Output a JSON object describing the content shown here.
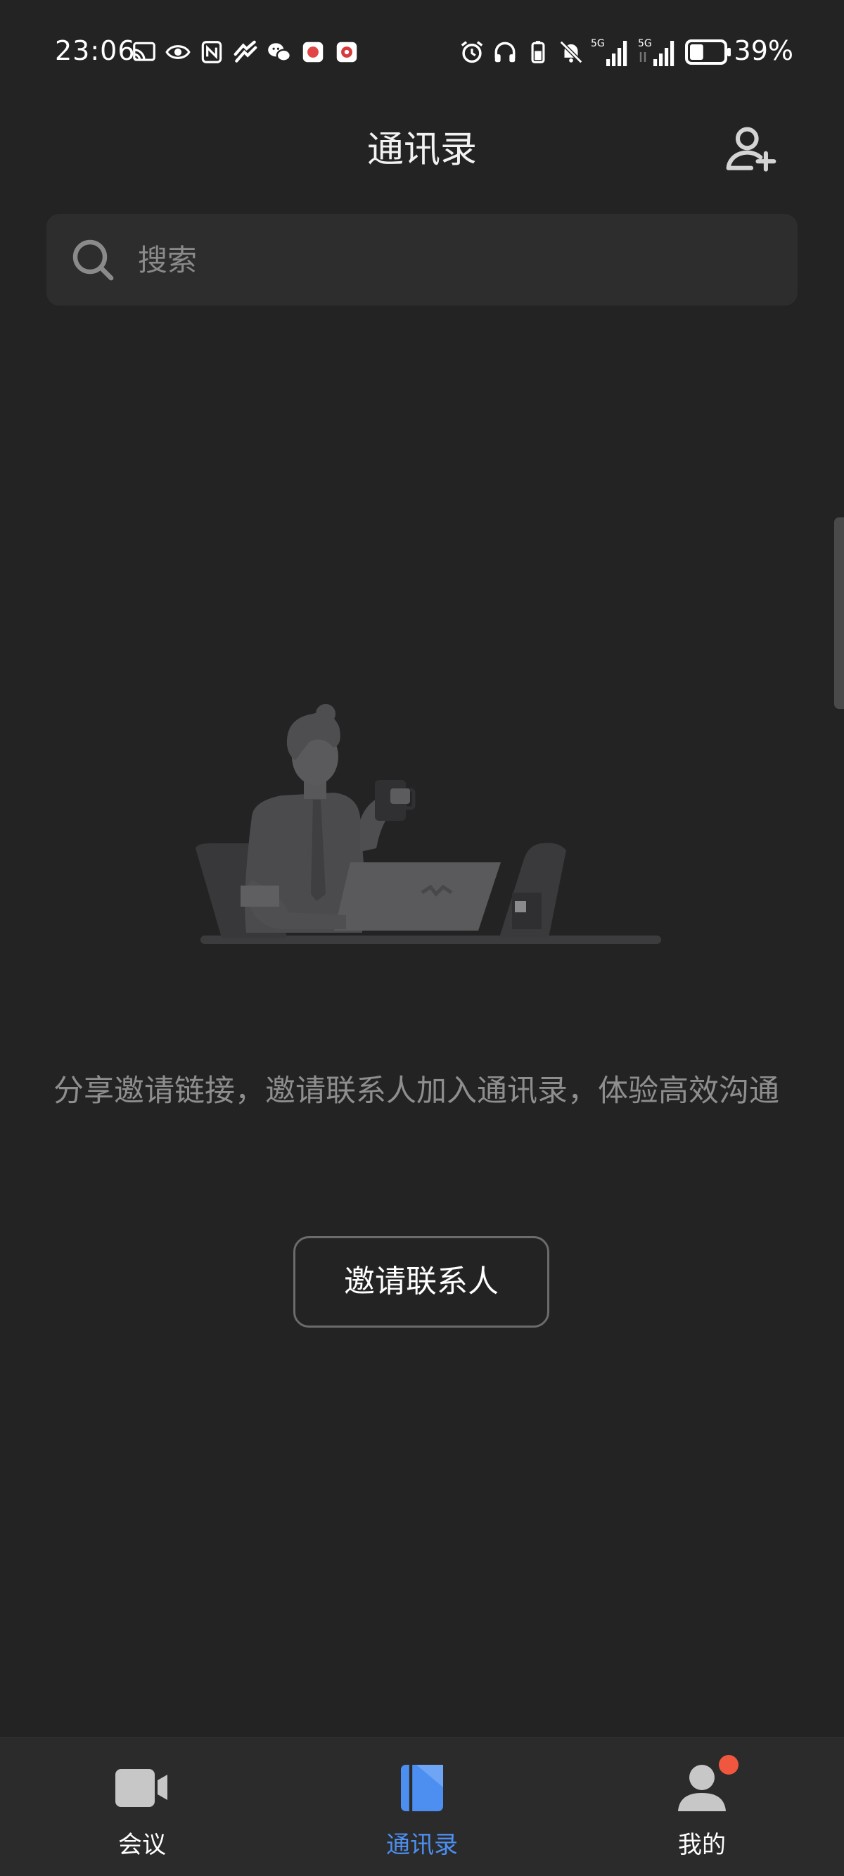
{
  "status_bar": {
    "time": "23:06",
    "battery_percent": "39%",
    "battery_level": 0.39,
    "network_1": "5G",
    "network_2": "5G",
    "left_icons": [
      "screen-cast-icon",
      "eye-icon",
      "nfc-icon",
      "sports-app-icon",
      "wechat-icon",
      "app-notification-icon",
      "app-notification-icon"
    ],
    "right_icons": [
      "alarm-icon",
      "headphones-icon",
      "battery-saver-icon",
      "mute-icon",
      "signal-icon",
      "signal-icon",
      "battery-icon"
    ]
  },
  "header": {
    "title": "通讯录",
    "add_icon": "add-contact-icon"
  },
  "search": {
    "placeholder": "搜索",
    "value": ""
  },
  "empty_state": {
    "illustration": "person-at-desk-illustration",
    "message": "分享邀请链接，邀请联系人加入通讯录，体验高效沟通",
    "button_label": "邀请联系人"
  },
  "bottom_nav": {
    "items": [
      {
        "label": "会议",
        "icon": "video-camera-icon",
        "active": false
      },
      {
        "label": "通讯录",
        "icon": "contacts-book-icon",
        "active": true
      },
      {
        "label": "我的",
        "icon": "profile-icon",
        "active": false,
        "badge": true
      }
    ]
  },
  "colors": {
    "background": "#232323",
    "surface": "#2d2d2d",
    "accent": "#4d8ff0",
    "badge": "#f0573e",
    "muted_text": "#8e8e8e"
  }
}
